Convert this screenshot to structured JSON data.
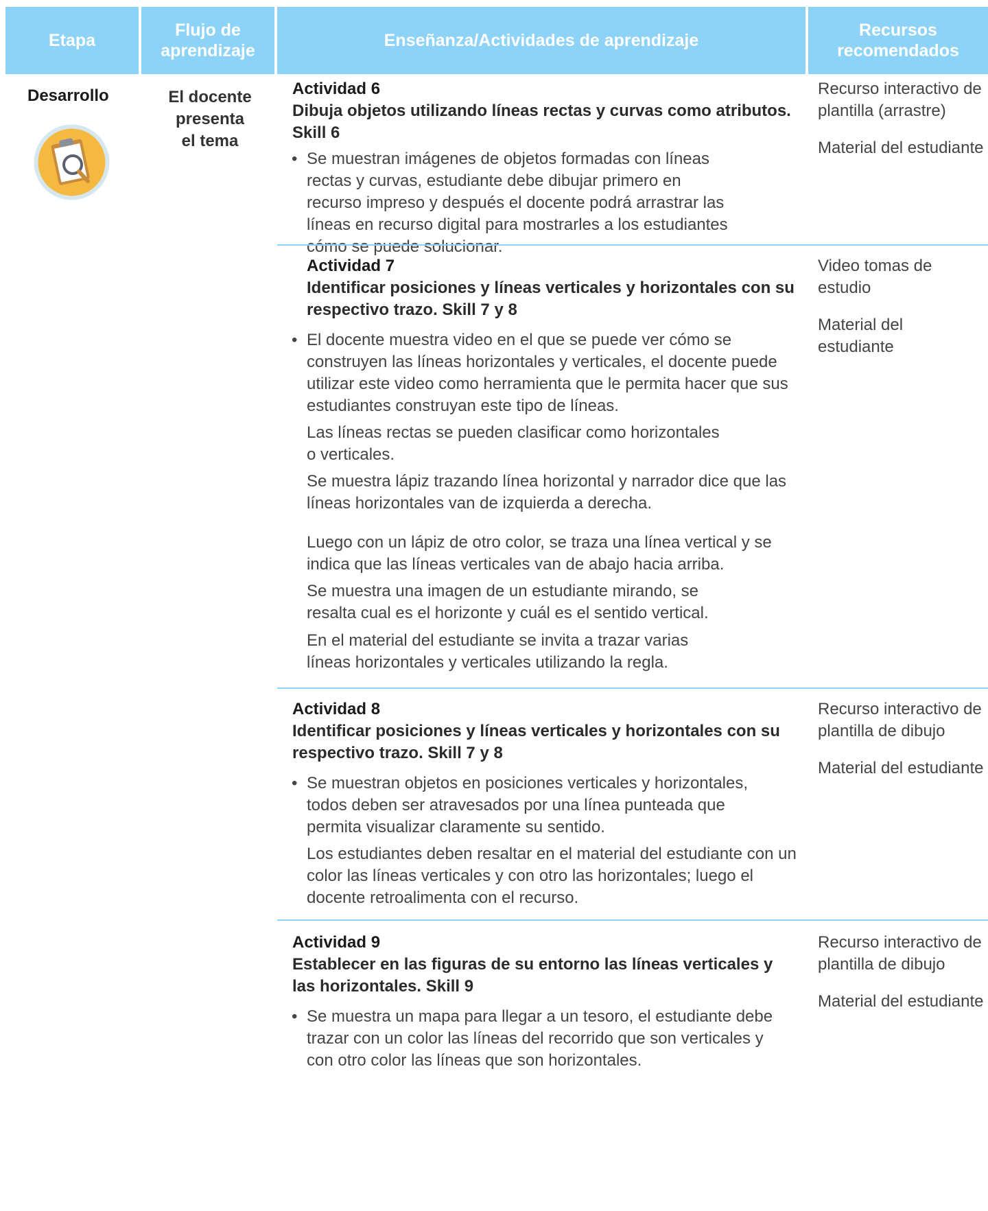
{
  "header": {
    "stage": "Etapa",
    "flow": "Flujo de aprendizaje",
    "teaching": "Enseñanza/Actividades de aprendizaje",
    "resources": "Recursos recomendados"
  },
  "stage": {
    "label": "Desarrollo",
    "icon": "clipboard-magnifier-icon",
    "flow_line1": "El docente",
    "flow_line2": "presenta",
    "flow_line3": "el tema"
  },
  "activities": [
    {
      "number": "Actividad 6",
      "title": "Dibuja objetos utilizando líneas rectas y curvas como atributos. Skill 6",
      "paragraphs": [
        "Se muestran imágenes de objetos formadas con líneas rectas y curvas, estudiante debe dibujar primero en recurso impreso y después el docente podrá arrastrar las líneas en recurso digital para mostrarles a los estudiantes cómo se puede solucionar."
      ],
      "resources": [
        "Recurso interactivo de plantilla (arrastre)",
        "Material del estudiante"
      ]
    },
    {
      "number": "Actividad 7",
      "title": "Identificar posiciones y líneas verticales y horizontales con su respectivo trazo. Skill 7 y 8",
      "paragraphs": [
        "El docente muestra video en el que se puede ver cómo se construyen las líneas horizontales y verticales, el docente puede utilizar este video como herramienta que le permita hacer que sus estudiantes construyan este tipo de líneas.",
        "Las líneas rectas se pueden clasificar como horizontales o verticales.",
        "Se muestra lápiz trazando línea horizontal y narrador dice que las líneas horizontales van de izquierda a derecha.",
        "Luego con un lápiz de otro color, se traza una línea vertical y se indica que las líneas verticales van de abajo hacia arriba.",
        "Se muestra una imagen de un estudiante mirando, se resalta cual es el horizonte y cuál es el sentido vertical.",
        "En el material del estudiante se invita a trazar varias líneas horizontales y verticales utilizando la regla."
      ],
      "resources": [
        "Video tomas de estudio",
        "Material del estudiante"
      ]
    },
    {
      "number": "Actividad 8",
      "title": "Identificar posiciones y líneas verticales y horizontales con su respectivo trazo. Skill 7 y 8",
      "paragraphs": [
        "Se muestran objetos en posiciones verticales y horizontales, todos deben ser atravesados por una línea punteada que permita visualizar claramente su sentido.",
        "Los estudiantes deben resaltar en el material del estudiante con un color las líneas verticales y con otro las horizontales; luego el docente retroalimenta con el recurso."
      ],
      "resources": [
        "Recurso interactivo de plantilla de dibujo",
        "Material del estudiante"
      ]
    },
    {
      "number": "Actividad 9",
      "title": "Establecer en las figuras de su entorno las líneas verticales y las horizontales. Skill 9",
      "paragraphs": [
        "Se muestra un mapa para llegar a un tesoro, el estudiante debe trazar con un color las líneas del recorrido que son verticales y con otro color las líneas que son horizontales."
      ],
      "resources": [
        "Recurso interactivo de plantilla de dibujo",
        "Material del estudiante"
      ]
    }
  ],
  "colors": {
    "header_bg": "#8dd3f8",
    "divider": "#8dd3f8",
    "icon_circle": "#f5b942",
    "icon_ring": "#d6e7f0"
  }
}
